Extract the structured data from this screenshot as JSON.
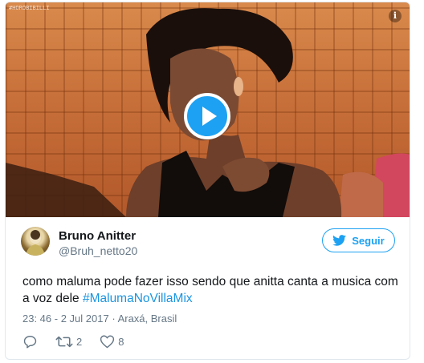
{
  "media": {
    "watermark": "#HOROBIBILLI",
    "info_glyph": "i",
    "play_icon": "play-icon"
  },
  "author": {
    "display_name": "Bruno Anitter",
    "screen_name": "@Bruh_netto20"
  },
  "follow": {
    "label": "Seguir",
    "icon": "twitter-bird-icon"
  },
  "tweet": {
    "text_before": "como maluma pode fazer isso sendo que anitta canta a musica com a voz dele ",
    "hashtag": "#MalumaNoVillaMix"
  },
  "meta": {
    "time": "23: 46 - 2 Jul 2017",
    "separator": "·",
    "location": "Araxá, Brasil"
  },
  "actions": {
    "reply_icon": "reply-icon",
    "retweet_icon": "retweet-icon",
    "retweet_count": "2",
    "like_icon": "heart-icon",
    "like_count": "8"
  },
  "colors": {
    "accent": "#1da1f2",
    "hashtag": "#1b95e0",
    "secondary_text": "#657786",
    "border": "#e1e8ed"
  }
}
